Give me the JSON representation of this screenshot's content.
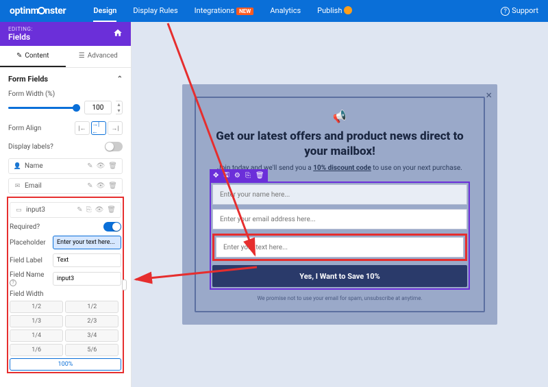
{
  "brand": "optinmonster",
  "nav": {
    "design": "Design",
    "display_rules": "Display Rules",
    "integrations": "Integrations",
    "integrations_badge": "NEW",
    "analytics": "Analytics",
    "publish": "Publish",
    "support": "Support"
  },
  "editing": {
    "label": "EDITING:",
    "section": "Fields"
  },
  "tabs": {
    "content": "Content",
    "advanced": "Advanced"
  },
  "form_fields": {
    "title": "Form Fields",
    "form_width_label": "Form Width (%)",
    "form_width_value": "100",
    "form_align_label": "Form Align",
    "display_labels_label": "Display labels?",
    "items": [
      {
        "label": "Name"
      },
      {
        "label": "Email"
      },
      {
        "label": "input3"
      }
    ],
    "required_label": "Required?",
    "placeholder_label": "Placeholder",
    "placeholder_value": "Enter your text here...",
    "field_label_label": "Field Label",
    "field_label_value": "Text",
    "field_name_label": "Field Name",
    "field_name_value": "input3",
    "field_width_label": "Field Width",
    "widths": [
      "1/2",
      "1/2",
      "1/3",
      "2/3",
      "1/4",
      "3/4",
      "1/6",
      "5/6",
      "100%"
    ]
  },
  "popup": {
    "heading": "Get our latest offers and product news direct to your mailbox!",
    "sub_pre": "Join today and we'll send you a ",
    "sub_bold": "10% discount code",
    "sub_post": " to use on your next purchase.",
    "ph_name": "Enter your name here...",
    "ph_email": "Enter your email address here...",
    "ph_text": "Enter your text here...",
    "cta": "Yes, I Want to Save 10%",
    "fineprint": "We promise not to use your email for spam, unsubscribe at anytime."
  }
}
